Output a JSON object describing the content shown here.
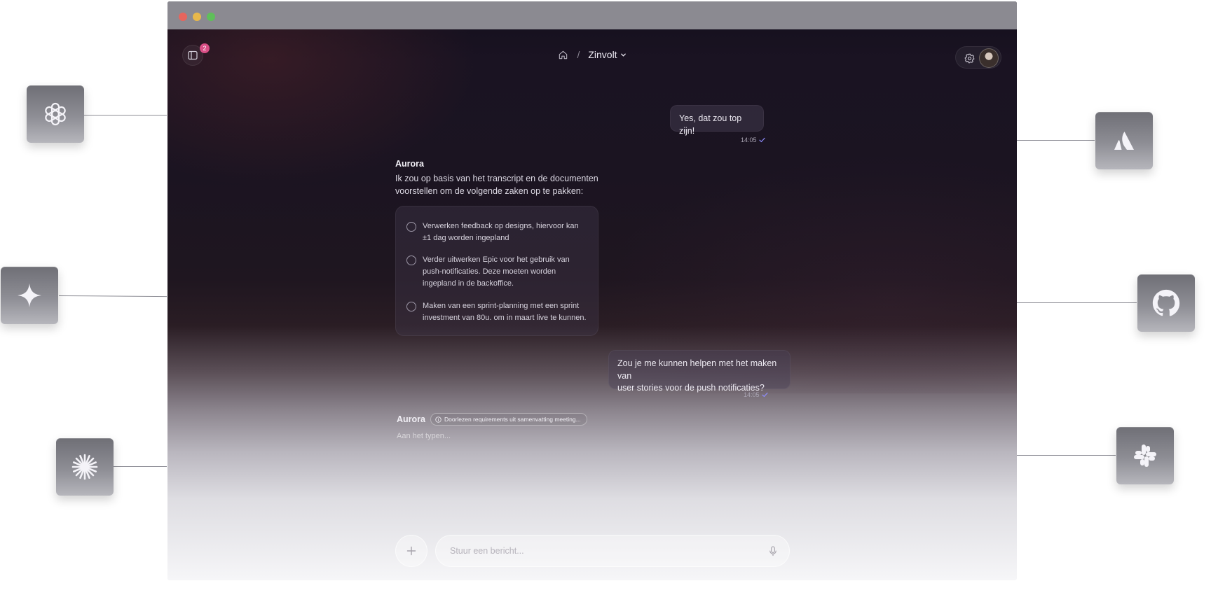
{
  "window": {
    "traffic_lights": {
      "close_color": "#e7655d",
      "minimize_color": "#e8b84a",
      "maximize_color": "#5fbf5a"
    }
  },
  "header": {
    "notification_count": "2",
    "breadcrumb_separator": "/",
    "workspace_name": "Zinvolt"
  },
  "chat": {
    "messages": [
      {
        "role": "user",
        "text": "Yes, dat zou top zijn!",
        "time": "14:05"
      },
      {
        "role": "assistant",
        "author": "Aurora",
        "text_line1": "Ik zou op basis van het transcript en de documenten",
        "text_line2": "voorstellen om de volgende zaken op te pakken:",
        "tasks": [
          {
            "line1": "Verwerken feedback op designs, hiervoor kan",
            "line2": "±1 dag worden ingepland",
            "done": false
          },
          {
            "line1": "Verder uitwerken Epic voor het gebruik van",
            "line2": "push-notificaties. Deze moeten worden",
            "line3": "ingepland in de backoffice.",
            "done": false
          },
          {
            "line1": "Maken van een sprint-planning met een sprint",
            "line2": "investment van 80u. om in maart live te kunnen.",
            "done": false
          }
        ]
      },
      {
        "role": "user",
        "text_line1": "Zou je me kunnen helpen met het maken van",
        "text_line2": "user stories voor de push notificaties?",
        "time": "14:05"
      }
    ],
    "pending": {
      "author": "Aurora",
      "status": "Doorlezen requirements uit samenvatting meeting...",
      "typing": "Aan het typen..."
    }
  },
  "composer": {
    "placeholder": "Stuur een bericht..."
  },
  "integrations": [
    {
      "icon": "openai-icon",
      "side": "left"
    },
    {
      "icon": "sparkle-icon",
      "side": "left"
    },
    {
      "icon": "claude-starburst-icon",
      "side": "left"
    },
    {
      "icon": "atlassian-icon",
      "side": "right"
    },
    {
      "icon": "github-icon",
      "side": "right"
    },
    {
      "icon": "slack-icon",
      "side": "right"
    }
  ],
  "colors": {
    "accent_badge": "#d94f86",
    "read_check": "#8f8cff",
    "tile_icon": "#f4f3f8"
  }
}
